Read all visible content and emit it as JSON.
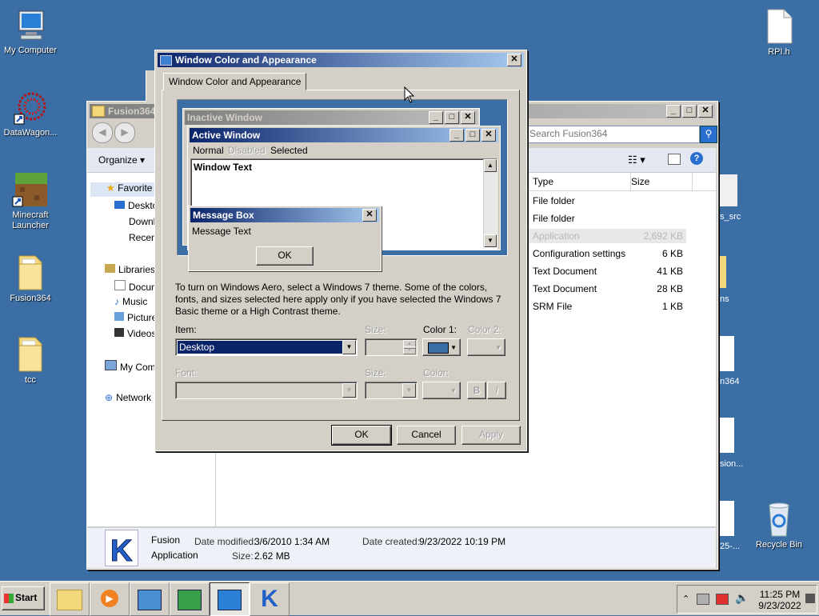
{
  "desktop": {
    "icons": [
      {
        "label": "My Computer"
      },
      {
        "label": "DataWagon..."
      },
      {
        "label": "Minecraft Launcher"
      },
      {
        "label": "Fusion364"
      },
      {
        "label": "tcc"
      },
      {
        "label": "RPI.h"
      },
      {
        "label": "Recycle Bin"
      }
    ],
    "partial_labels": [
      "s_src",
      "ns",
      "n364",
      "sion...",
      "25-..."
    ]
  },
  "explorer": {
    "title": "Fusion364",
    "search_placeholder": "Search Fusion364",
    "organize_label": "Organize",
    "nav": {
      "favorites": "Favorite",
      "desktop": "Deskto",
      "downloads": "Downlo",
      "recent": "Recen",
      "libraries": "Libraries",
      "documents": "Docum",
      "music": "Music",
      "pictures": "Picture",
      "videos": "Videos",
      "computer": "My Comp",
      "network": "Network"
    },
    "columns": {
      "type": "Type",
      "size": "Size"
    },
    "rows": [
      {
        "type": "File folder",
        "size": ""
      },
      {
        "type": "File folder",
        "size": ""
      },
      {
        "type": "Application",
        "size": "2,692 KB"
      },
      {
        "type": "Configuration settings",
        "size": "6 KB"
      },
      {
        "type": "Text Document",
        "size": "41 KB"
      },
      {
        "type": "Text Document",
        "size": "28 KB"
      },
      {
        "type": "SRM File",
        "size": "1 KB"
      }
    ],
    "details": {
      "name": "Fusion",
      "kind": "Application",
      "modified_label": "Date modified:",
      "modified_value": "3/6/2010 1:34 AM",
      "size_label": "Size:",
      "size_value": "2.62 MB",
      "created_label": "Date created:",
      "created_value": "9/23/2022 10:19 PM"
    }
  },
  "dialog": {
    "title": "Window Color and Appearance",
    "tab": "Window Color and Appearance",
    "preview": {
      "inactive_title": "Inactive Window",
      "active_title": "Active Window",
      "menu": [
        "Normal",
        "Disabled",
        "Selected"
      ],
      "window_text": "Window Text",
      "msgbox_title": "Message Box",
      "msgbox_text": "Message Text",
      "msgbox_ok": "OK"
    },
    "description": "To turn on Windows Aero, select a Windows 7 theme.  Some of the colors, fonts, and sizes selected here apply only if you have selected the Windows 7 Basic theme or a High Contrast theme.",
    "item_label": "Item:",
    "item_value": "Desktop",
    "size_label": "Size:",
    "color1_label": "Color 1:",
    "color2_label": "Color 2:",
    "color1_value": "#3a6ea5",
    "font_label": "Font:",
    "font_size_label": "Size:",
    "font_color_label": "Color:",
    "bold_label": "B",
    "italic_label": "I",
    "ok_label": "OK",
    "cancel_label": "Cancel",
    "apply_label": "Apply"
  },
  "taskbar": {
    "start_label": "Start",
    "time": "11:25 PM",
    "date": "9/23/2022"
  },
  "colors": {
    "desktop": "#3a6ea5",
    "title_active": "#0a246a",
    "title_gradient": "#a6caf0",
    "face": "#d4d0c8"
  }
}
